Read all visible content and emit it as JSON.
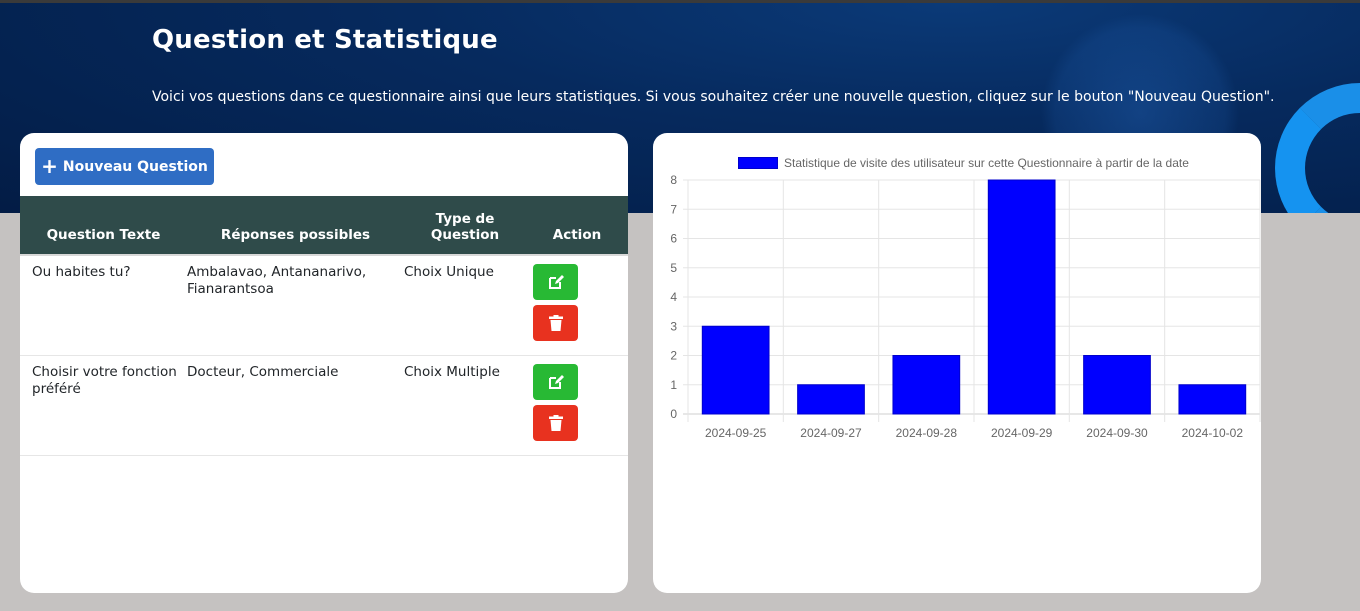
{
  "header": {
    "title": "Question et Statistique",
    "description": "Voici vos questions dans ce questionnaire ainsi que leurs statistiques. Si vous souhaitez créer une nouvelle question, cliquez sur le bouton \"Nouveau Question\"."
  },
  "questions_panel": {
    "new_button_label": "Nouveau Question",
    "columns": [
      "Question Texte",
      "Réponses possibles",
      "Type de Question",
      "Action"
    ],
    "rows": [
      {
        "text": "Ou habites tu?",
        "answers": "Ambalavao, Antananarivo, Fianarantsoa",
        "type": "Choix Unique"
      },
      {
        "text": "Choisir votre fonction préféré",
        "answers": "Docteur, Commerciale",
        "type": "Choix Multiple"
      }
    ]
  },
  "chart_data": {
    "type": "bar",
    "legend": "Statistique de visite des utilisateur sur cette Questionnaire à partir de la date",
    "legend_position": "top",
    "categories": [
      "2024-09-25",
      "2024-09-27",
      "2024-09-28",
      "2024-09-29",
      "2024-09-30",
      "2024-10-02"
    ],
    "values": [
      3,
      1,
      2,
      8,
      2,
      1
    ],
    "ylim": [
      0,
      8
    ],
    "yticks": [
      0,
      1,
      2,
      3,
      4,
      5,
      6,
      7,
      8
    ],
    "grid": true,
    "bar_color": "#0000ff"
  },
  "colors": {
    "header_bg": "#062a5e",
    "table_header_bg": "#2f4b4a",
    "primary_button": "#2f6dc4",
    "edit_button": "#28b934",
    "delete_button": "#e8321f",
    "page_bg": "#c5c2c1"
  },
  "icons": {
    "new_button": "plus-icon",
    "edit": "pencil-square-icon",
    "delete": "trash-icon"
  }
}
